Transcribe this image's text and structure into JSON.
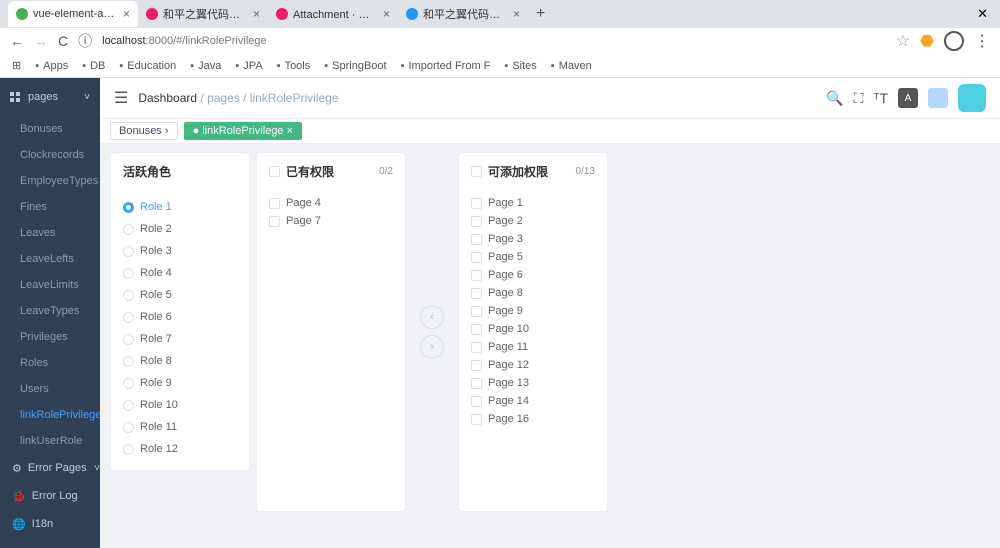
{
  "browser": {
    "tabs": [
      {
        "title": "vue-element-admin",
        "icon": "#4caf50"
      },
      {
        "title": "和平之翼代码生成器SME",
        "icon": "#e91e63"
      },
      {
        "title": "Attachment · 火鸟/和平之",
        "icon": "#e91e63"
      },
      {
        "title": "和平之翼代码生成器SME",
        "icon": "#2196f3"
      }
    ],
    "url_prefix": "localhost",
    "url_rest": ":8000/#/linkRolePrivilege",
    "refresh_label": "C",
    "bookmarks": [
      "Apps",
      "DB",
      "Education",
      "Java",
      "JPA",
      "Tools",
      "SpringBoot",
      "Imported From F",
      "Sites",
      "Maven"
    ]
  },
  "sidebar": {
    "header": "pages",
    "items": [
      "Bonuses",
      "Clockrecords",
      "EmployeeTypes",
      "Fines",
      "Leaves",
      "LeaveLefts",
      "LeaveLimits",
      "LeaveTypes",
      "Privileges",
      "Roles",
      "Users",
      "linkRolePrivilege",
      "linkUserRole"
    ],
    "active_index": 11,
    "sections": [
      {
        "icon": "⚙",
        "label": "Error Pages",
        "chev": true
      },
      {
        "icon": "🐞",
        "label": "Error Log"
      },
      {
        "icon": "🌐",
        "label": "I18n"
      }
    ]
  },
  "topbar": {
    "breadcrumb": [
      "Dashboard",
      "pages",
      "linkRolePrivilege"
    ]
  },
  "tagsview": {
    "tags": [
      {
        "label": "Bonuses",
        "active": false
      },
      {
        "label": "linkRolePrivilege",
        "active": true
      }
    ]
  },
  "roles": {
    "title": "活跃角色",
    "items": [
      "Role 1",
      "Role 2",
      "Role 3",
      "Role 4",
      "Role 5",
      "Role 6",
      "Role 7",
      "Role 8",
      "Role 9",
      "Role 10",
      "Role 11",
      "Role 12"
    ],
    "selected_index": 0
  },
  "transfer": {
    "left": {
      "title": "已有权限",
      "count": "0/2",
      "items": [
        "Page 4",
        "Page 7"
      ]
    },
    "right": {
      "title": "可添加权限",
      "count": "0/13",
      "items": [
        "Page 1",
        "Page 2",
        "Page 3",
        "Page 5",
        "Page 6",
        "Page 8",
        "Page 9",
        "Page 10",
        "Page 11",
        "Page 12",
        "Page 13",
        "Page 14",
        "Page 16"
      ]
    }
  }
}
